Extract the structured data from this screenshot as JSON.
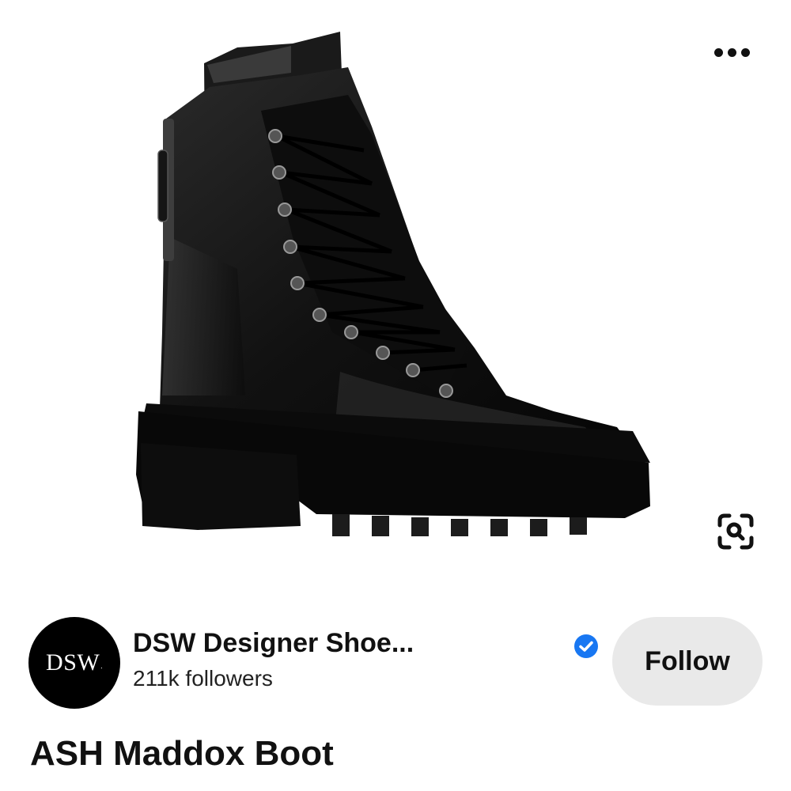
{
  "pin": {
    "image_alt": "Black leather lace-up combat boot with lug sole and back zipper",
    "title": "ASH Maddox Boot"
  },
  "toolbar": {
    "more_icon": "more-horizontal-icon",
    "visual_search_icon": "visual-search-icon"
  },
  "creator": {
    "avatar_text": "DSW",
    "name": "DSW Designer Shoe...",
    "followers": "211k followers",
    "verified_icon": "verified-badge-icon",
    "follow_label": "Follow"
  },
  "colors": {
    "verified_blue": "#1877F2",
    "follow_bg": "#e9e9e9",
    "text": "#111111"
  }
}
